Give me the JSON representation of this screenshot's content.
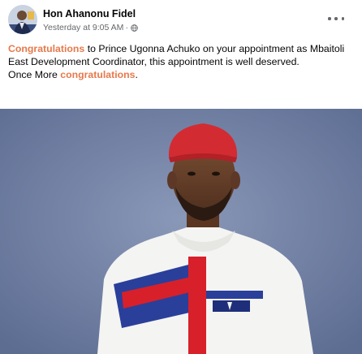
{
  "post": {
    "author": "Hon Ahanonu Fidel",
    "timestamp": "Yesterday at 9:05 AM",
    "separator": "·",
    "audience_icon": "globe-icon",
    "more_icon": "more-options-icon",
    "text": {
      "congrats_word": "Congratulations",
      "line1_rest": " to Prince Ugonna Achuko on your appointment as Mbaitoli East Development Coordinator, this appointment is well deserved.",
      "line2_prefix": "Once More ",
      "congrats_word_lower": "congratulations",
      "line2_suffix": "."
    }
  },
  "colors": {
    "highlight": "#e6794b",
    "meta_text": "#65676b",
    "photo_background": "#7484a6",
    "cap_red": "#d32b32",
    "shirt_white": "#f4f4f2",
    "shirt_blue": "#2a3f9a",
    "shirt_red": "#d8202a"
  }
}
